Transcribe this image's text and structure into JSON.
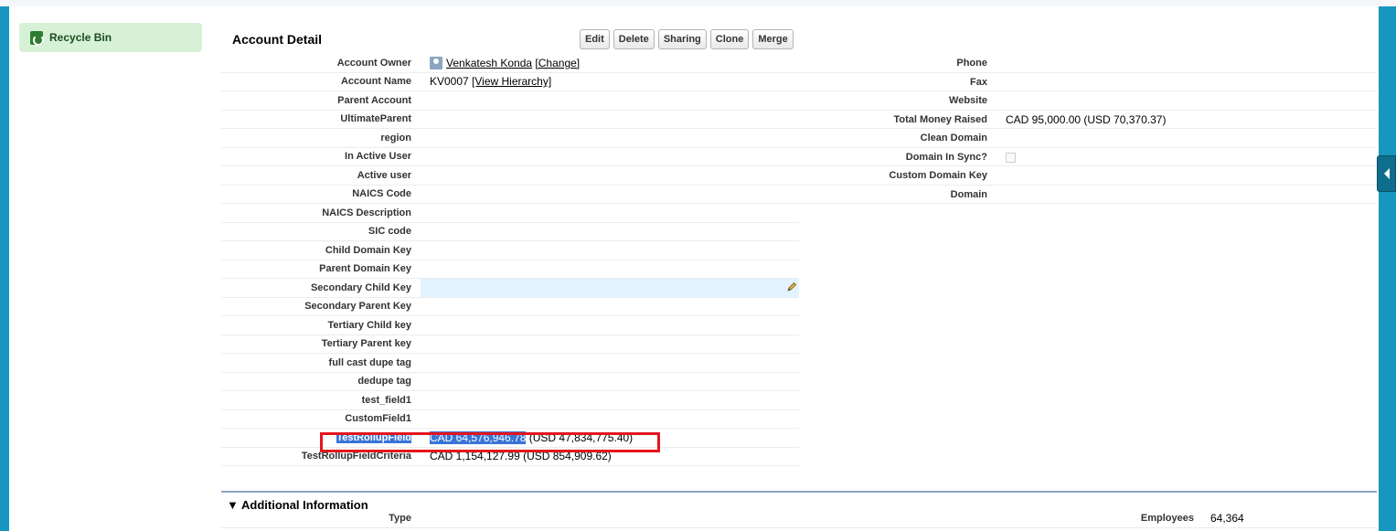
{
  "sidebar": {
    "recycle_bin": "Recycle Bin"
  },
  "detail": {
    "title": "Account Detail",
    "buttons": [
      "Edit",
      "Delete",
      "Sharing",
      "Clone",
      "Merge"
    ],
    "owner_name": "Venkatesh Konda",
    "owner_change": "[Change]",
    "account_name": "KV0007",
    "view_hierarchy": "[View Hierarchy]",
    "left_fields": [
      {
        "label": "Account Owner",
        "value": ""
      },
      {
        "label": "Account Name",
        "value": ""
      },
      {
        "label": "Parent Account",
        "value": ""
      },
      {
        "label": "UltimateParent",
        "value": ""
      },
      {
        "label": "region",
        "value": ""
      },
      {
        "label": "In Active User",
        "value": ""
      },
      {
        "label": "Active user",
        "value": ""
      },
      {
        "label": "NAICS Code",
        "value": ""
      },
      {
        "label": "NAICS Description",
        "value": ""
      },
      {
        "label": "SIC code",
        "value": ""
      },
      {
        "label": "Child Domain Key",
        "value": ""
      },
      {
        "label": "Parent Domain Key",
        "value": ""
      },
      {
        "label": "Secondary Child Key",
        "value": ""
      },
      {
        "label": "Secondary Parent Key",
        "value": ""
      },
      {
        "label": "Tertiary Child key",
        "value": ""
      },
      {
        "label": "Tertiary Parent key",
        "value": ""
      },
      {
        "label": "full cast dupe tag",
        "value": ""
      },
      {
        "label": "dedupe tag",
        "value": ""
      },
      {
        "label": "test_field1",
        "value": ""
      },
      {
        "label": "CustomField1",
        "value": ""
      },
      {
        "label": "TestRollupField",
        "value": ""
      },
      {
        "label": "TestRollupFieldCriteria",
        "value": "CAD 1,154,127.99 (USD 854,909.62)"
      }
    ],
    "rollup_selected": "CAD 64,576,946.78",
    "rollup_rest": " (USD 47,834,775.40)",
    "right_fields": [
      {
        "label": "Phone",
        "value": ""
      },
      {
        "label": "Fax",
        "value": ""
      },
      {
        "label": "Website",
        "value": ""
      },
      {
        "label": "Total Money Raised",
        "value": "CAD 95,000.00 (USD 70,370.37)"
      },
      {
        "label": "Clean Domain",
        "value": ""
      },
      {
        "label": "Domain In Sync?",
        "value": ""
      },
      {
        "label": "Custom Domain Key",
        "value": ""
      },
      {
        "label": "Domain",
        "value": ""
      }
    ]
  },
  "additional": {
    "title": "▼ Additional Information",
    "type_label": "Type",
    "employees_label": "Employees",
    "employees_value": "64,364"
  }
}
